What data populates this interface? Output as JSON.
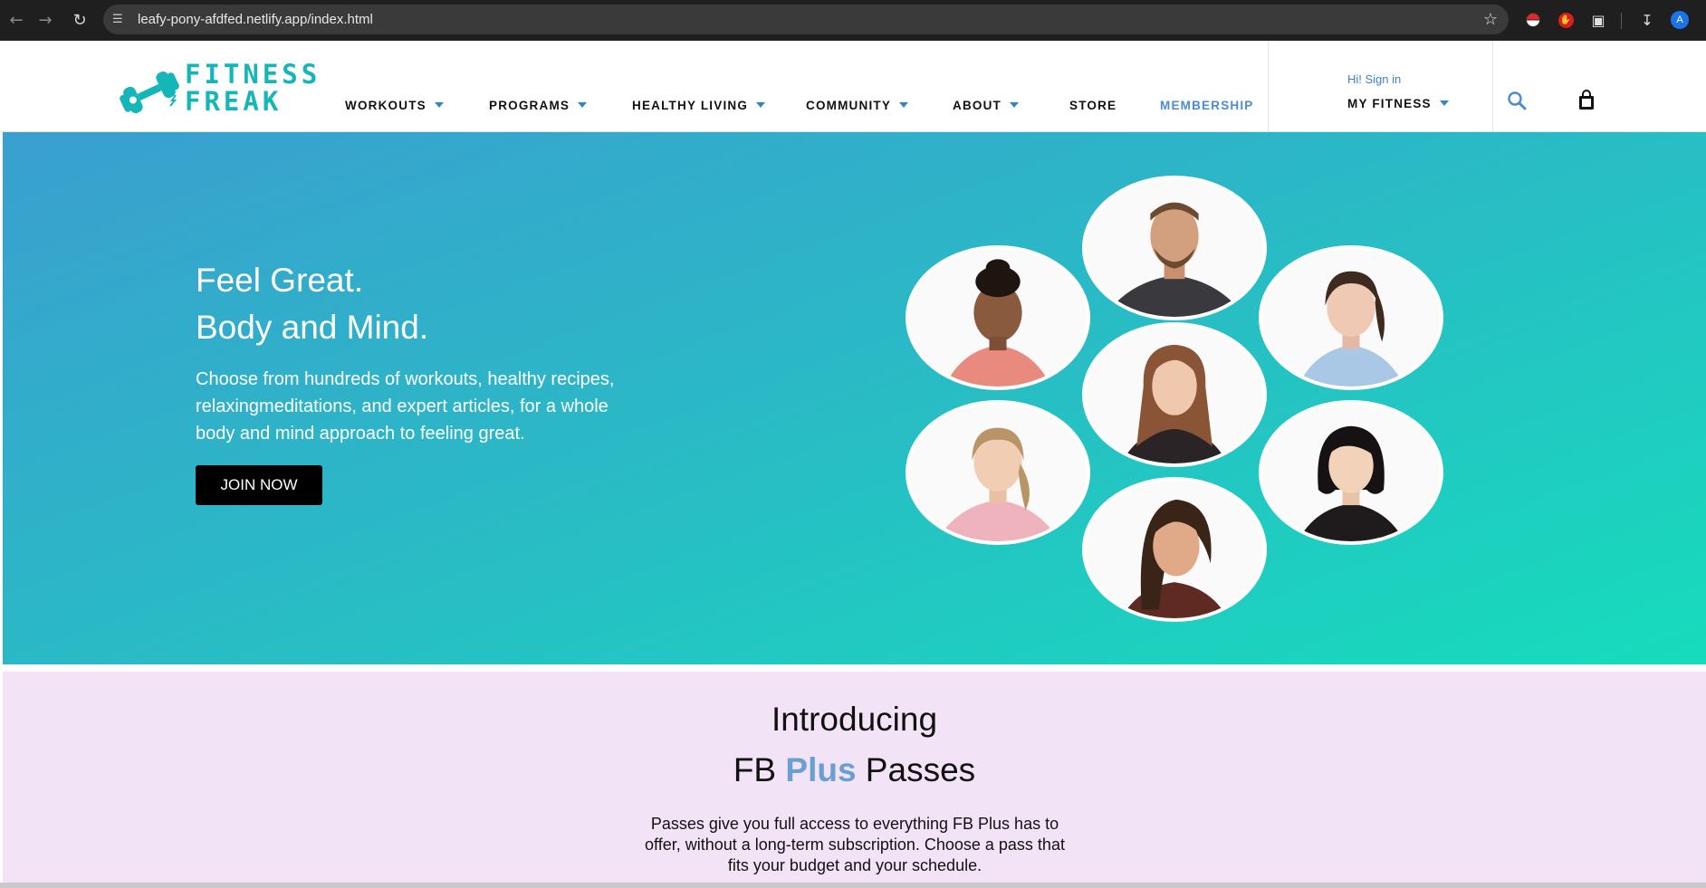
{
  "browser": {
    "url": "leafy-pony-afdfed.netlify.app/index.html",
    "profile_initial": "A",
    "icons": [
      "back-icon",
      "forward-icon",
      "reload-icon",
      "site-settings-icon",
      "bookmark-star-icon",
      "pokeball-extension-icon",
      "stop-extension-icon",
      "puzzle-extension-icon",
      "download-icon",
      "avatar"
    ]
  },
  "header": {
    "logo_line1": "FITNESS",
    "logo_line2": "FREAK",
    "menu": [
      {
        "label": "WORKOUTS",
        "dropdown": true
      },
      {
        "label": "PROGRAMS",
        "dropdown": true
      },
      {
        "label": "HEALTHY LIVING",
        "dropdown": true
      },
      {
        "label": "COMMUNITY",
        "dropdown": true
      },
      {
        "label": "ABOUT",
        "dropdown": true
      },
      {
        "label": "STORE",
        "dropdown": false
      },
      {
        "label": "MEMBERSHIP",
        "dropdown": false
      }
    ],
    "signin": "Hi! Sign in",
    "my_fitness": "MY FITNESS",
    "accent_color": "#4b8bd0",
    "logo_color": "#15b6b8"
  },
  "hero": {
    "title_line1": "Feel Great.",
    "title_line2": "Body and Mind.",
    "text": "Choose from hundreds of workouts, healthy recipes, relaxingmeditations, and expert articles, for a whole body and mind approach to feeling great.",
    "cta": "JOIN NOW",
    "gradient_from": "#3a9fd0",
    "gradient_to": "#16dcbc"
  },
  "intro": {
    "line1": "Introducing",
    "line2_pre": "FB ",
    "line2_accent": "Plus",
    "line2_post": " Passes",
    "text": "Passes give you full access to everything FB Plus has to offer, without a long-term subscription. Choose a pass that fits your budget and your schedule.",
    "accent_color": "#6a9fd3",
    "background": "#f2e4f6"
  }
}
